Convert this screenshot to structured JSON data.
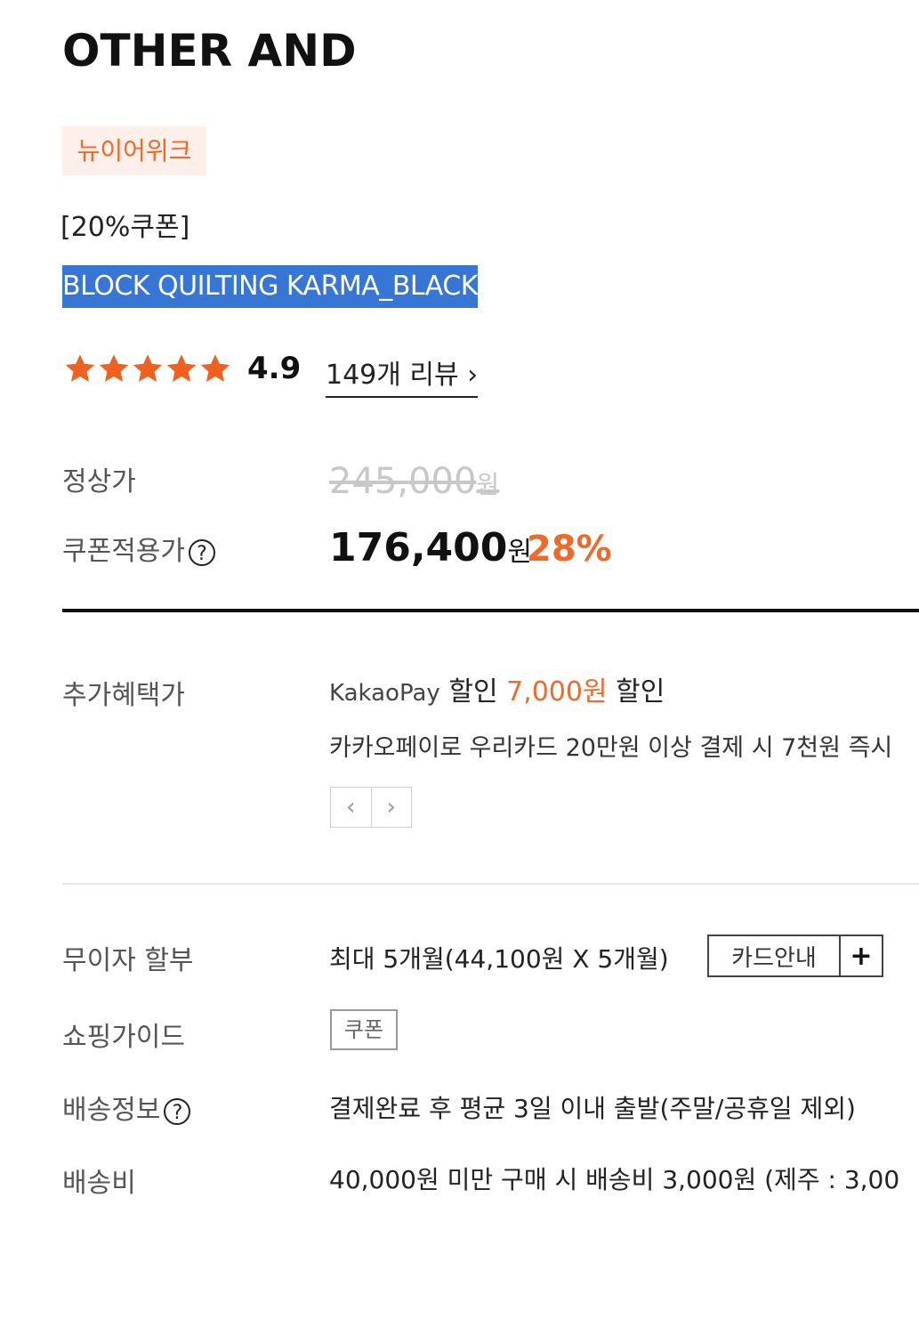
{
  "brand": "OTHER AND",
  "badge": "뉴이어위크",
  "coupon_tag": "[20%쿠폰]",
  "product_name": "BLOCK QUILTING KARMA_BLACK",
  "rating": {
    "stars": 5,
    "score": "4.9",
    "reviews_link": "149개 리뷰 ›"
  },
  "price": {
    "regular_label": "정상가",
    "regular_value": "245,000",
    "regular_unit": "원",
    "coupon_label": "쿠폰적용가",
    "coupon_help": "?",
    "coupon_value": "176,400",
    "coupon_unit": "원",
    "discount": "28%"
  },
  "benefit": {
    "label": "추가혜택가",
    "provider": "KakaoPay",
    "text1": "할인",
    "amount": "7,000원",
    "text2": "할인",
    "desc": "카카오페이로 우리카드 20만원 이상 결제 시 7천원 즉시",
    "prev": "‹",
    "next": "›"
  },
  "installment": {
    "label": "무이자 할부",
    "value": "최대 5개월(44,100원 X 5개월)",
    "card_button": "카드안내",
    "plus": "+"
  },
  "guide": {
    "label": "쇼핑가이드",
    "coupon_button": "쿠폰"
  },
  "shipping": {
    "label": "배송정보",
    "help": "?",
    "value": "결제완료 후 평균 3일 이내 출발(주말/공휴일 제외)"
  },
  "fee": {
    "label": "배송비",
    "value": "40,000원 미만 구매 시 배송비 3,000원 (제주 : 3,00"
  },
  "colors": {
    "accent": "#ee6a2a",
    "highlight": "#3776d4",
    "badge_bg": "#fdf0ea"
  }
}
